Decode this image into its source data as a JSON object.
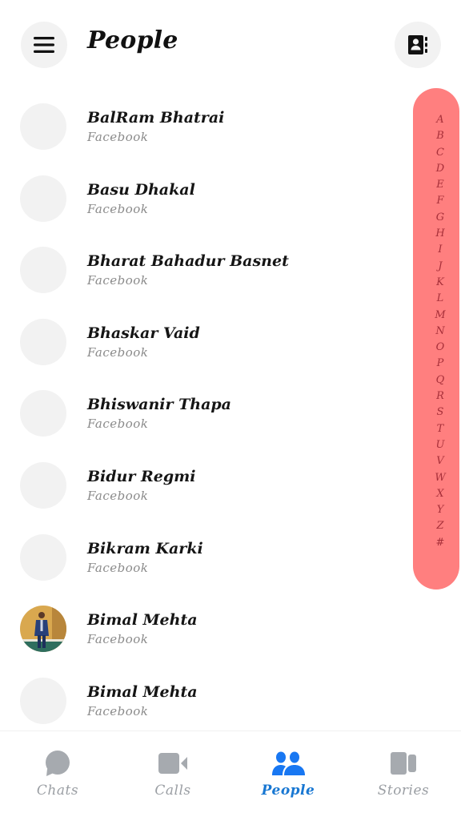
{
  "header": {
    "title": "People",
    "menu_icon": "hamburger-menu-icon",
    "contacts_icon": "contact-book-icon"
  },
  "contacts": [
    {
      "name": "BalRam Bhatrai",
      "source": "Facebook",
      "has_photo": false
    },
    {
      "name": "Basu Dhakal",
      "source": "Facebook",
      "has_photo": false
    },
    {
      "name": "Bharat Bahadur Basnet",
      "source": "Facebook",
      "has_photo": false
    },
    {
      "name": "Bhaskar Vaid",
      "source": "Facebook",
      "has_photo": false
    },
    {
      "name": "Bhiswanir Thapa",
      "source": "Facebook",
      "has_photo": false
    },
    {
      "name": "Bidur Regmi",
      "source": "Facebook",
      "has_photo": false
    },
    {
      "name": "Bikram Karki",
      "source": "Facebook",
      "has_photo": false
    },
    {
      "name": "Bimal Mehta",
      "source": "Facebook",
      "has_photo": true
    },
    {
      "name": "Bimal Mehta",
      "source": "Facebook",
      "has_photo": false
    }
  ],
  "alphabet_index": {
    "letters": [
      "A",
      "B",
      "C",
      "D",
      "E",
      "F",
      "G",
      "H",
      "I",
      "J",
      "K",
      "L",
      "M",
      "N",
      "O",
      "P",
      "Q",
      "R",
      "S",
      "T",
      "U",
      "V",
      "W",
      "X",
      "Y",
      "Z",
      "#"
    ],
    "background_color": "#ff7f7f",
    "letter_color": "#a8303a"
  },
  "tabbar": {
    "active_color": "#1877d2",
    "inactive_color": "#9a9ea3",
    "tabs": [
      {
        "label": "Chats",
        "icon": "chat-bubble-icon",
        "active": false
      },
      {
        "label": "Calls",
        "icon": "video-camera-icon",
        "active": false
      },
      {
        "label": "People",
        "icon": "people-icon",
        "active": true
      },
      {
        "label": "Stories",
        "icon": "stories-icon",
        "active": false
      }
    ]
  }
}
